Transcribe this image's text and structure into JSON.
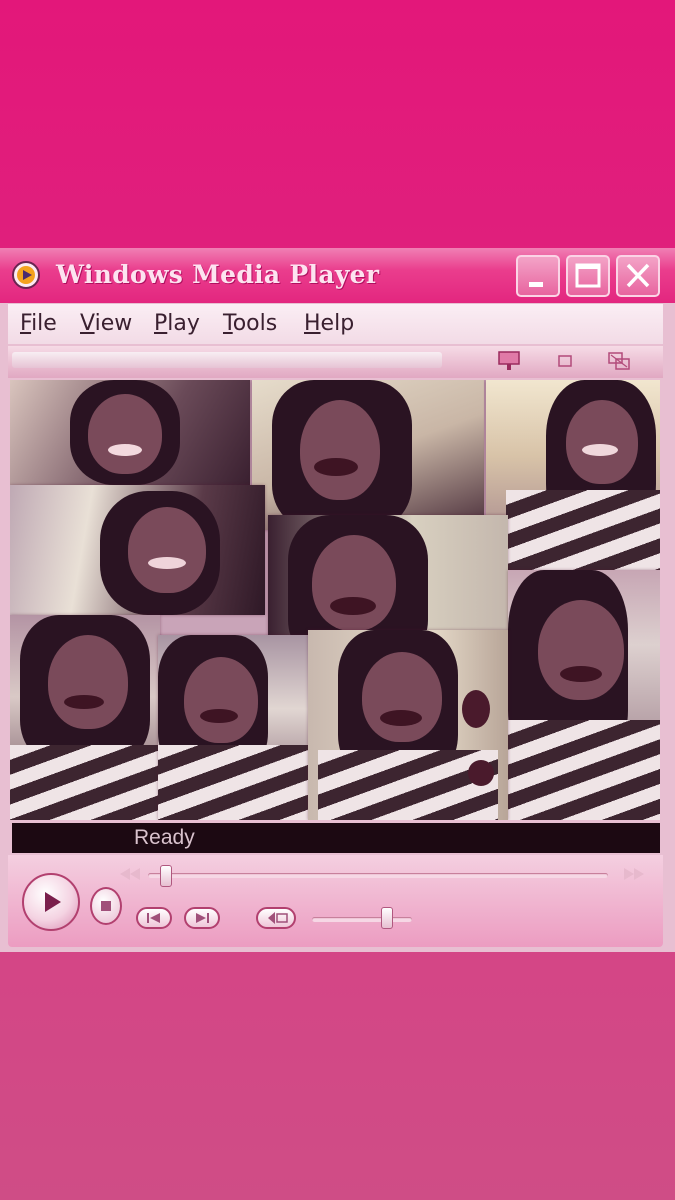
{
  "window": {
    "title": "Windows Media Player",
    "icon": "media-player-icon"
  },
  "titlebar_buttons": [
    "minimize-icon",
    "maximize-icon",
    "close-icon"
  ],
  "menu": {
    "items": [
      {
        "first": "F",
        "rest": "ile"
      },
      {
        "first": "V",
        "rest": "iew"
      },
      {
        "first": "P",
        "rest": "lay"
      },
      {
        "first": "T",
        "rest": "ools"
      },
      {
        "first": "H",
        "rest": "elp"
      }
    ]
  },
  "toolstrip_icons": [
    "now-playing-icon",
    "compact-mode-icon",
    "skin-mode-icon"
  ],
  "status": {
    "text": "Ready"
  },
  "controls": {
    "play": "play-icon",
    "stop": "stop-icon",
    "previous": "previous-track-icon",
    "next": "next-track-icon",
    "mute": "mute-icon",
    "rewind": "rewind-icon",
    "fast_forward": "fast-forward-icon",
    "seek_position": 0.04,
    "volume_level": 0.75
  },
  "colors": {
    "accent": "#e3177a",
    "titlebar": "#e3267f",
    "controls": "#ec9cc1"
  }
}
